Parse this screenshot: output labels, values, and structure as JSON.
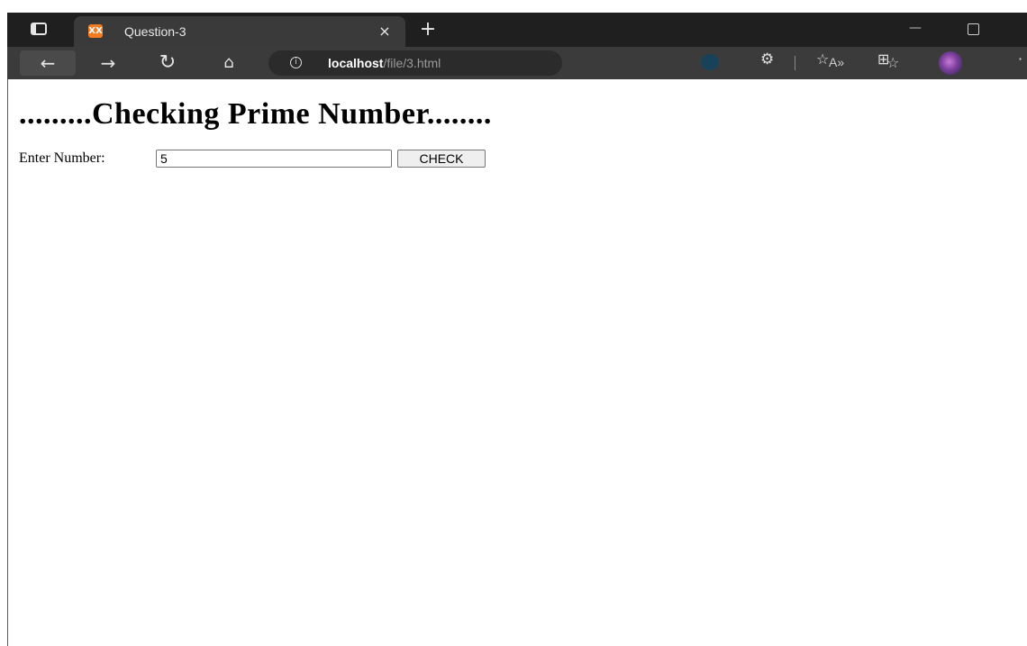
{
  "browser": {
    "tab": {
      "title": "Question-3",
      "favicon_text": "XX",
      "close_glyph": "×"
    },
    "new_tab_glyph": "+",
    "window_controls": {
      "minimize_glyph": "—"
    },
    "toolbar": {
      "back_glyph": "←",
      "forward_glyph": "→",
      "reload_glyph": "↻",
      "home_glyph": "⌂",
      "info_glyph": "i",
      "url_host": "localhost",
      "url_path": "/file/3.html",
      "read_aloud_glyph": "A»",
      "add_favorite_glyph": "☆",
      "extensions_glyph": "⚙",
      "favorites_glyph": "☆",
      "collections_glyph": "⊞",
      "more_glyph": "·"
    },
    "colors": {
      "tabstrip_bg": "#1f1f1f",
      "toolbar_bg": "#3b3b3b",
      "favicon_bg": "#f57c20"
    }
  },
  "page": {
    "title": ".........Checking Prime Number........",
    "form": {
      "label": "Enter Number:",
      "input_value": "5",
      "button_label": "CHECK"
    }
  }
}
